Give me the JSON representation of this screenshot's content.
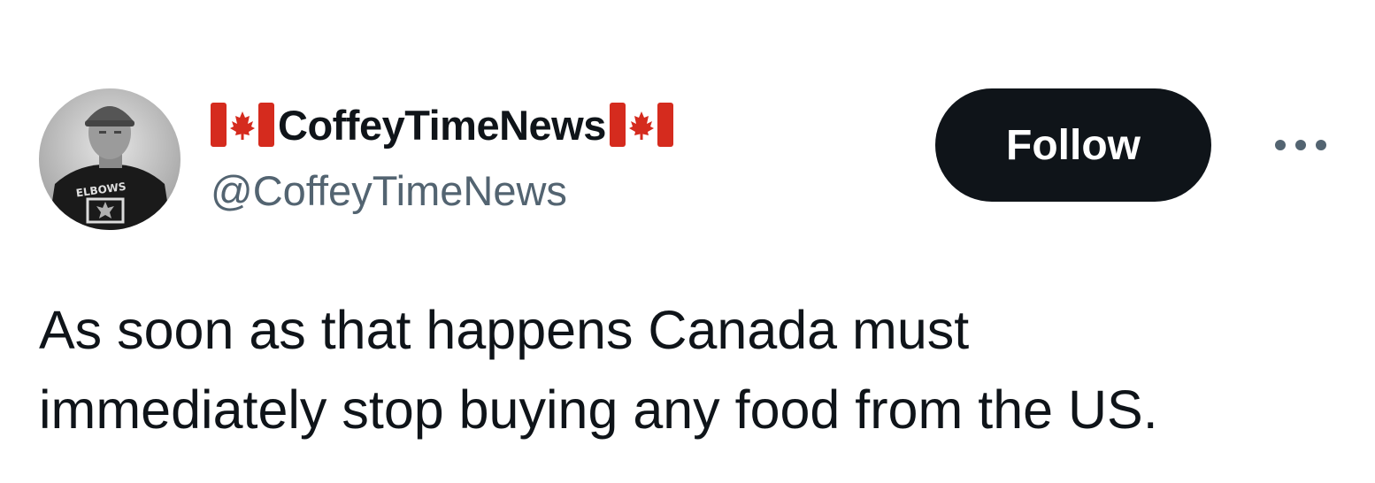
{
  "author": {
    "display_name": "CoffeyTimeNews",
    "handle": "@CoffeyTimeNews",
    "flag_emoji_left": "canada-flag-icon",
    "flag_emoji_right": "canada-flag-icon",
    "avatar_shirt_text": "ELBOWS"
  },
  "actions": {
    "follow_label": "Follow",
    "more_icon": "more-horizontal-icon"
  },
  "tweet": {
    "text": "As soon as that happens Canada must\nimmediately stop buying any food from the US."
  },
  "colors": {
    "text_primary": "#0f1419",
    "text_secondary": "#536471",
    "button_bg": "#0f1419",
    "button_text": "#ffffff",
    "flag_red": "#d52b1e"
  }
}
